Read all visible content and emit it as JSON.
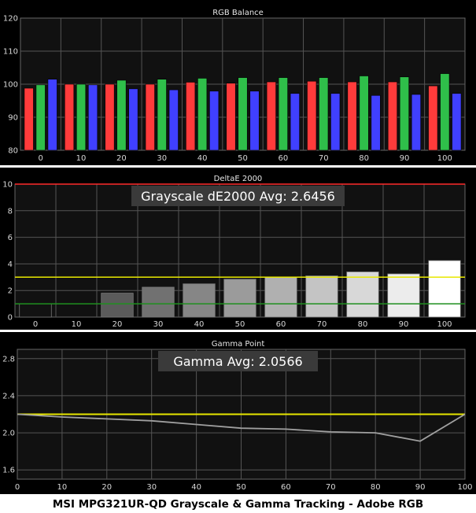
{
  "caption": "MSI MPG321UR-QD Grayscale & Gamma Tracking - Adobe RGB",
  "colors": {
    "panel_bg": "#000000",
    "plot_bg": "#111111",
    "frame": "#666666",
    "grid": "#555555",
    "red": "#ff3b3b",
    "green": "#2fbf4a",
    "blue": "#4040ff",
    "yellow": "#e8e800",
    "limit_red": "#ff2a2a",
    "limit_green": "#1f8f1f",
    "gamma_line": "#a0a0a0",
    "avg_box": "#3a3a3a"
  },
  "chart_data": [
    {
      "type": "bar",
      "title": "RGB Balance",
      "categories": [
        "0",
        "10",
        "20",
        "30",
        "40",
        "50",
        "60",
        "70",
        "80",
        "90",
        "100"
      ],
      "ylim": [
        80,
        120
      ],
      "yticks": [
        80,
        90,
        100,
        110,
        120
      ],
      "grid": true,
      "series": [
        {
          "color": "red",
          "values": [
            98.8,
            100.0,
            100.0,
            100.0,
            100.6,
            100.3,
            100.7,
            100.9,
            100.7,
            100.7,
            99.5
          ]
        },
        {
          "color": "green",
          "values": [
            99.8,
            100.0,
            101.2,
            101.5,
            101.8,
            102.0,
            102.0,
            102.0,
            102.5,
            102.2,
            103.2
          ]
        },
        {
          "color": "blue",
          "values": [
            101.5,
            99.8,
            98.6,
            98.3,
            97.9,
            97.9,
            97.2,
            97.2,
            96.6,
            96.9,
            97.2
          ]
        }
      ]
    },
    {
      "type": "bar",
      "title": "DeltaE 2000",
      "annotation": "Grayscale dE2000 Avg: 2.6456",
      "categories": [
        "0",
        "10",
        "20",
        "30",
        "40",
        "50",
        "60",
        "70",
        "80",
        "90",
        "100"
      ],
      "values": [
        1.0,
        0.0,
        1.8,
        2.25,
        2.5,
        2.85,
        3.0,
        3.1,
        3.4,
        3.25,
        4.25
      ],
      "ylim": [
        0,
        10
      ],
      "yticks": [
        0,
        2,
        4,
        6,
        8,
        10
      ],
      "reference_lines": [
        {
          "value": 10,
          "color": "limit_red"
        },
        {
          "value": 3,
          "color": "yellow"
        },
        {
          "value": 1,
          "color": "limit_green"
        }
      ]
    },
    {
      "type": "line",
      "title": "Gamma Point",
      "annotation": "Gamma Avg: 2.0566",
      "x": [
        0,
        10,
        20,
        30,
        40,
        50,
        60,
        70,
        80,
        90,
        100
      ],
      "y": [
        2.2,
        2.17,
        2.15,
        2.13,
        2.09,
        2.05,
        2.04,
        2.01,
        2.0,
        1.91,
        2.2
      ],
      "xlim": [
        0,
        100
      ],
      "ylim": [
        1.5,
        2.9
      ],
      "yticks": [
        1.6,
        2.0,
        2.4,
        2.8
      ],
      "xticks": [
        0,
        10,
        20,
        30,
        40,
        50,
        60,
        70,
        80,
        90,
        100
      ],
      "target": 2.2
    }
  ]
}
